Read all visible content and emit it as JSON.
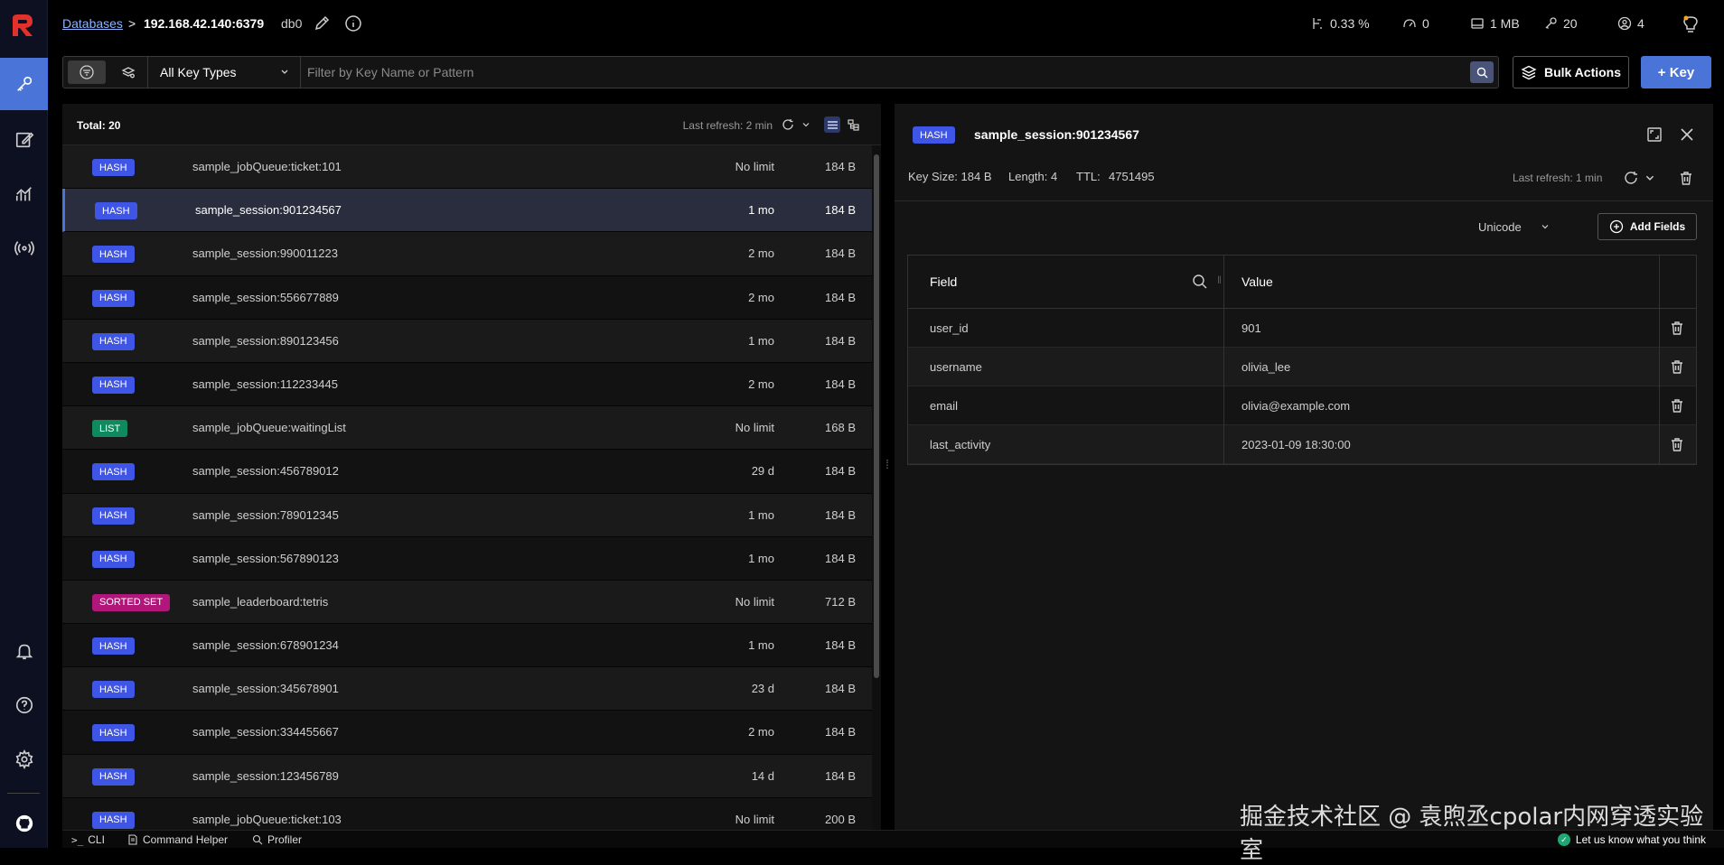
{
  "header": {
    "breadcrumb_link": "Databases",
    "breadcrumb_sep": ">",
    "host": "192.168.42.140:6379",
    "db": "db0",
    "stats": {
      "cpu": "0.33 %",
      "ops": "0",
      "memory": "1 MB",
      "keys": "20",
      "clients": "4"
    }
  },
  "filter": {
    "key_type": "All Key Types",
    "placeholder": "Filter by Key Name or Pattern",
    "bulk_actions": "Bulk Actions",
    "add_key": "+ Key"
  },
  "list": {
    "total": "Total: 20",
    "last_refresh": "Last refresh: 2 min",
    "keys": [
      {
        "type": "HASH",
        "name": "sample_jobQueue:ticket:101",
        "ttl": "No limit",
        "size": "184 B"
      },
      {
        "type": "HASH",
        "name": "sample_session:901234567",
        "ttl": "1 mo",
        "size": "184 B",
        "selected": true
      },
      {
        "type": "HASH",
        "name": "sample_session:990011223",
        "ttl": "2 mo",
        "size": "184 B"
      },
      {
        "type": "HASH",
        "name": "sample_session:556677889",
        "ttl": "2 mo",
        "size": "184 B"
      },
      {
        "type": "HASH",
        "name": "sample_session:890123456",
        "ttl": "1 mo",
        "size": "184 B"
      },
      {
        "type": "HASH",
        "name": "sample_session:112233445",
        "ttl": "2 mo",
        "size": "184 B"
      },
      {
        "type": "LIST",
        "name": "sample_jobQueue:waitingList",
        "ttl": "No limit",
        "size": "168 B"
      },
      {
        "type": "HASH",
        "name": "sample_session:456789012",
        "ttl": "29 d",
        "size": "184 B"
      },
      {
        "type": "HASH",
        "name": "sample_session:789012345",
        "ttl": "1 mo",
        "size": "184 B"
      },
      {
        "type": "HASH",
        "name": "sample_session:567890123",
        "ttl": "1 mo",
        "size": "184 B"
      },
      {
        "type": "SORTED SET",
        "name": "sample_leaderboard:tetris",
        "ttl": "No limit",
        "size": "712 B"
      },
      {
        "type": "HASH",
        "name": "sample_session:678901234",
        "ttl": "1 mo",
        "size": "184 B"
      },
      {
        "type": "HASH",
        "name": "sample_session:345678901",
        "ttl": "23 d",
        "size": "184 B"
      },
      {
        "type": "HASH",
        "name": "sample_session:334455667",
        "ttl": "2 mo",
        "size": "184 B"
      },
      {
        "type": "HASH",
        "name": "sample_session:123456789",
        "ttl": "14 d",
        "size": "184 B"
      },
      {
        "type": "HASH",
        "name": "sample_jobQueue:ticket:103",
        "ttl": "No limit",
        "size": "200 B"
      }
    ]
  },
  "detail": {
    "type": "HASH",
    "key_name": "sample_session:901234567",
    "key_size": "Key Size: 184 B",
    "length": "Length: 4",
    "ttl_label": "TTL:",
    "ttl_value": "4751495",
    "last_refresh": "Last refresh: 1 min",
    "encoding": "Unicode",
    "add_fields": "Add Fields",
    "col_field": "Field",
    "col_value": "Value",
    "fields": [
      {
        "field": "user_id",
        "value": "901"
      },
      {
        "field": "username",
        "value": "olivia_lee"
      },
      {
        "field": "email",
        "value": "olivia@example.com"
      },
      {
        "field": "last_activity",
        "value": "2023-01-09 18:30:00"
      }
    ]
  },
  "bottom": {
    "cli": "CLI",
    "command_helper": "Command Helper",
    "profiler": "Profiler",
    "feedback": "Let us know what you think"
  },
  "watermark": "掘金技术社区 @ 袁煦丞cpolar内网穿透实验室",
  "colors": {
    "accent": "#4a74d8",
    "hash": "#3f55e6",
    "list": "#0f8a5f",
    "sorted_set": "#b1177a",
    "logo": "#e0312d"
  }
}
